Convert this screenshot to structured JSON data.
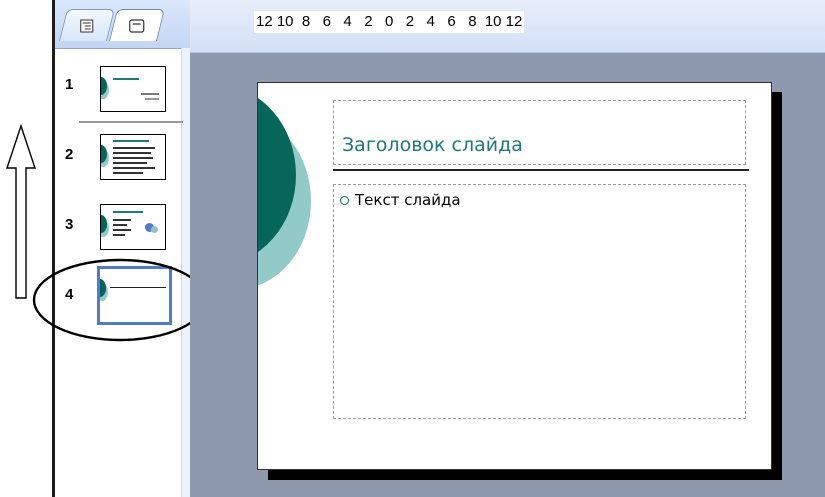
{
  "panel": {
    "tabs": [
      {
        "icon": "outline-icon"
      },
      {
        "icon": "slides-icon",
        "selected": true
      }
    ],
    "slides": [
      {
        "number": "1"
      },
      {
        "number": "2"
      },
      {
        "number": "3"
      },
      {
        "number": "4",
        "selected": true
      }
    ]
  },
  "ruler": {
    "ticks": [
      "12",
      "10",
      "8",
      "6",
      "4",
      "2",
      "0",
      "2",
      "4",
      "6",
      "8",
      "10",
      "12"
    ]
  },
  "slide": {
    "title": "Заголовок слайда",
    "body_bullet": "Текст слайда"
  },
  "colors": {
    "accent_dark": "#056459",
    "accent_light": "#94c9c9",
    "title_text": "#1d7a76",
    "selection_border": "#4f7bcb",
    "workspace": "#8f99ad"
  },
  "annotations": {
    "arrow": "up-arrow",
    "ellipse": "highlight-ellipse"
  }
}
